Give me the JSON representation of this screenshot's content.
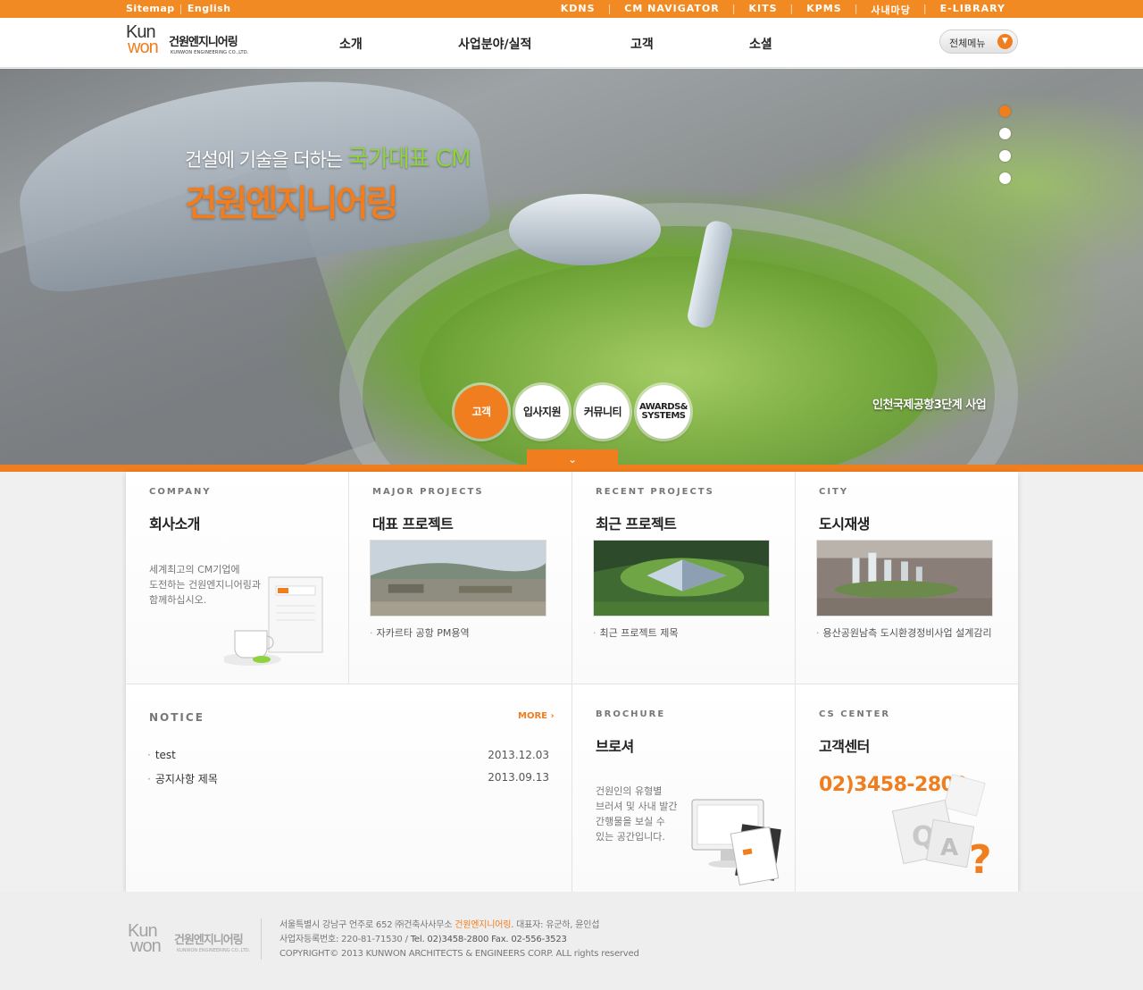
{
  "topbar": {
    "left": [
      "Sitemap",
      "English"
    ],
    "right": [
      "KDNS",
      "CM NAVIGATOR",
      "KITS",
      "KPMS",
      "사내마당",
      "E-LIBRARY"
    ]
  },
  "logo": {
    "mark_top": "Kun",
    "mark_bottom": "won",
    "name": "건원엔지니어링",
    "name_en": "KUNWON ENGINEERING CO.,LTD."
  },
  "nav": {
    "items": [
      "소개",
      "사업분야/실적",
      "고객",
      "소셜"
    ]
  },
  "all_menu": {
    "label": "전체메뉴",
    "icon": "chevron-down-icon"
  },
  "hero": {
    "slogan_prefix": "건설에 기술을 더하는",
    "slogan_highlight": "국가대표 CM",
    "slogan_main": "건원엔지니어링",
    "caption": "인천국제공항3단계 사업",
    "slide_count": 4,
    "active_slide": 1,
    "quick_links": [
      "고객",
      "입사지원",
      "커뮤니티",
      "AWARDS& SYSTEMS"
    ],
    "drop_icon": "chevron-down-icon"
  },
  "colors": {
    "accent": "#f07d1e",
    "highlight_green": "#8ed23d"
  },
  "company": {
    "en": "COMPANY",
    "kr": "회사소개",
    "desc": [
      "세계최고의 CM기업에",
      "도전하는 건원엔지니어링과",
      "함께하십시오."
    ]
  },
  "major": {
    "en": "MAJOR PROJECTS",
    "kr": "대표 프로젝트",
    "caption": "자카르타 공항 PM용역"
  },
  "recent": {
    "en": "RECENT PROJECTS",
    "kr": "최근 프로젝트",
    "caption": "최근 프로젝트 제목"
  },
  "city": {
    "en": "CITY",
    "kr": "도시재생",
    "caption": "용산공원남측 도시환경정비사업 설계감리"
  },
  "notice": {
    "en": "NOTICE",
    "more": "MORE",
    "items": [
      {
        "title": "test",
        "date": "2013.12.03"
      },
      {
        "title": "공지사항 제목",
        "date": "2013.09.13"
      }
    ]
  },
  "brochure": {
    "en": "BROCHURE",
    "kr": "브로셔",
    "desc": [
      "건원인의 유형별",
      "브러셔 및 사내 발간",
      "간행물을 보실 수",
      "있는 공간입니다."
    ]
  },
  "cs": {
    "en": "CS CENTER",
    "kr": "고객센터",
    "phone": "02)3458-2800"
  },
  "footer": {
    "line1_a": "서울특별시 강남구 언주로 652  ㈜건축사사무소",
    "line1_name": "건원엔지니어링",
    "line1_b": ".  대표자: 유군하, 윤인섭",
    "line2_a": "사업자등록번호: 220-81-71530 / ",
    "line2_tel": "Tel. 02)3458-2800",
    "line2_fax": "   Fax. 02-556-3523",
    "line3": "COPYRIGHT© 2013 KUNWON ARCHITECTS & ENGINEERS CORP. ALL rights reserved"
  }
}
